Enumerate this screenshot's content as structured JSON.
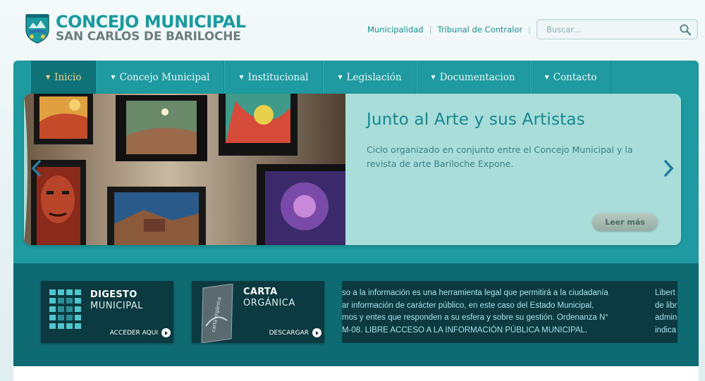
{
  "header": {
    "logo_line1": "CONCEJO MUNICIPAL",
    "logo_line2": "SAN CARLOS DE BARILOCHE",
    "links": [
      "Municipalidad",
      "Tribunal de Contralor"
    ],
    "search_placeholder": "Buscar..."
  },
  "nav": {
    "items": [
      {
        "label": "Inicio",
        "active": true
      },
      {
        "label": "Concejo Municipal"
      },
      {
        "label": "Institucional"
      },
      {
        "label": "Legislación"
      },
      {
        "label": "Documentacion"
      },
      {
        "label": "Contacto"
      }
    ]
  },
  "slider": {
    "title": "Junto al Arte y sus Artistas",
    "description": "Ciclo organizado en conjunto entre el Concejo Municipal y la revista de arte Bariloche Expone.",
    "read_more": "Leer más"
  },
  "boxes": {
    "digesto": {
      "title": "DIGESTO",
      "subtitle": "MUNICIPAL",
      "cta": "ACCEDER AQUI"
    },
    "carta": {
      "title": "CARTA",
      "subtitle": "ORGÁNICA",
      "cta": "DESCARGAR",
      "book_text": "carta orgánica"
    }
  },
  "ticker": {
    "lines": [
      "so a la información es una herramienta legal que permitirá a la ciudadanía",
      "ar información de carácter público, en este caso del Estado Municipal,",
      "mos y entes que responden a su esfera y  sobre su gestión. Ordenanza N°",
      "M-08. LIBRE ACCESO A LA INFORMACIÓN PÚBLICA MUNICIPAL."
    ],
    "side_lines": [
      "Libert",
      "de libr",
      "admin",
      "indica"
    ]
  },
  "colors": {
    "brand_teal": "#1e9aa0",
    "dark_teal": "#0e6b72",
    "box_dark": "#0b3a40",
    "active_nav_text": "#f0d48a"
  }
}
